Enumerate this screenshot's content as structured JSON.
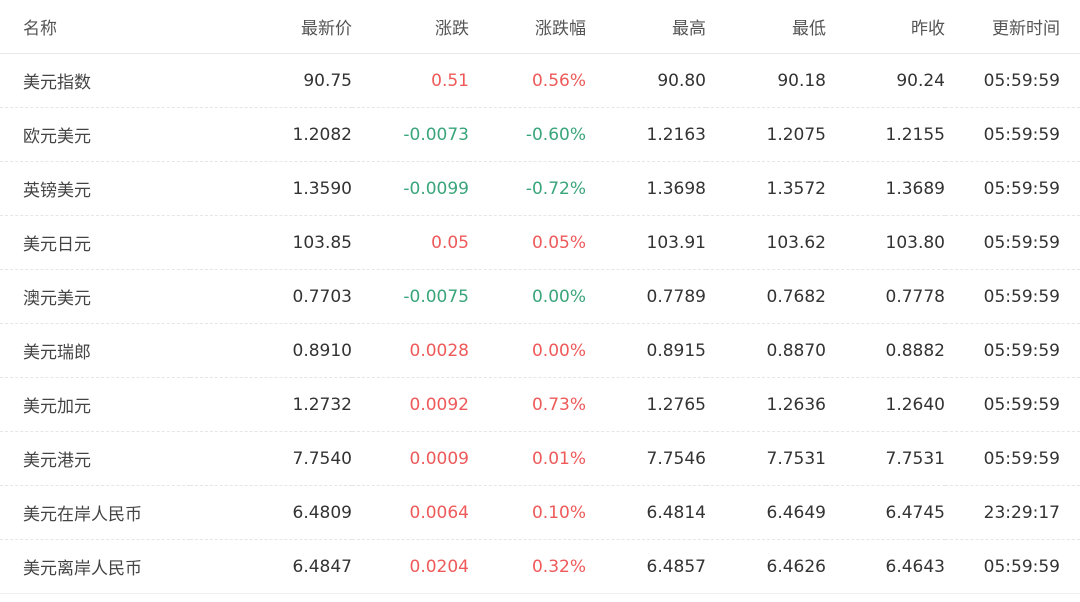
{
  "table": {
    "headers": [
      "名称",
      "最新价",
      "涨跌",
      "涨跌幅",
      "最高",
      "最低",
      "昨收",
      "更新时间"
    ],
    "rows": [
      {
        "name": "美元指数",
        "price": "90.75",
        "change": "0.51",
        "pct": "0.56%",
        "high": "90.80",
        "low": "90.18",
        "prev": "90.24",
        "time": "05:59:59",
        "change_dir": "up",
        "pct_dir": "up"
      },
      {
        "name": "欧元美元",
        "price": "1.2082",
        "change": "-0.0073",
        "pct": "-0.60%",
        "high": "1.2163",
        "low": "1.2075",
        "prev": "1.2155",
        "time": "05:59:59",
        "change_dir": "down",
        "pct_dir": "down"
      },
      {
        "name": "英镑美元",
        "price": "1.3590",
        "change": "-0.0099",
        "pct": "-0.72%",
        "high": "1.3698",
        "low": "1.3572",
        "prev": "1.3689",
        "time": "05:59:59",
        "change_dir": "down",
        "pct_dir": "down"
      },
      {
        "name": "美元日元",
        "price": "103.85",
        "change": "0.05",
        "pct": "0.05%",
        "high": "103.91",
        "low": "103.62",
        "prev": "103.80",
        "time": "05:59:59",
        "change_dir": "up",
        "pct_dir": "up"
      },
      {
        "name": "澳元美元",
        "price": "0.7703",
        "change": "-0.0075",
        "pct": "0.00%",
        "high": "0.7789",
        "low": "0.7682",
        "prev": "0.7778",
        "time": "05:59:59",
        "change_dir": "down",
        "pct_dir": "down"
      },
      {
        "name": "美元瑞郎",
        "price": "0.8910",
        "change": "0.0028",
        "pct": "0.00%",
        "high": "0.8915",
        "low": "0.8870",
        "prev": "0.8882",
        "time": "05:59:59",
        "change_dir": "up",
        "pct_dir": "up"
      },
      {
        "name": "美元加元",
        "price": "1.2732",
        "change": "0.0092",
        "pct": "0.73%",
        "high": "1.2765",
        "low": "1.2636",
        "prev": "1.2640",
        "time": "05:59:59",
        "change_dir": "up",
        "pct_dir": "up"
      },
      {
        "name": "美元港元",
        "price": "7.7540",
        "change": "0.0009",
        "pct": "0.01%",
        "high": "7.7546",
        "low": "7.7531",
        "prev": "7.7531",
        "time": "05:59:59",
        "change_dir": "up",
        "pct_dir": "up"
      },
      {
        "name": "美元在岸人民币",
        "price": "6.4809",
        "change": "0.0064",
        "pct": "0.10%",
        "high": "6.4814",
        "low": "6.4649",
        "prev": "6.4745",
        "time": "23:29:17",
        "change_dir": "up",
        "pct_dir": "up"
      },
      {
        "name": "美元离岸人民币",
        "price": "6.4847",
        "change": "0.0204",
        "pct": "0.32%",
        "high": "6.4857",
        "low": "6.4626",
        "prev": "6.4643",
        "time": "05:59:59",
        "change_dir": "up",
        "pct_dir": "up"
      }
    ]
  },
  "colors": {
    "up": "#ee5a5a",
    "down": "#3aa57a"
  }
}
